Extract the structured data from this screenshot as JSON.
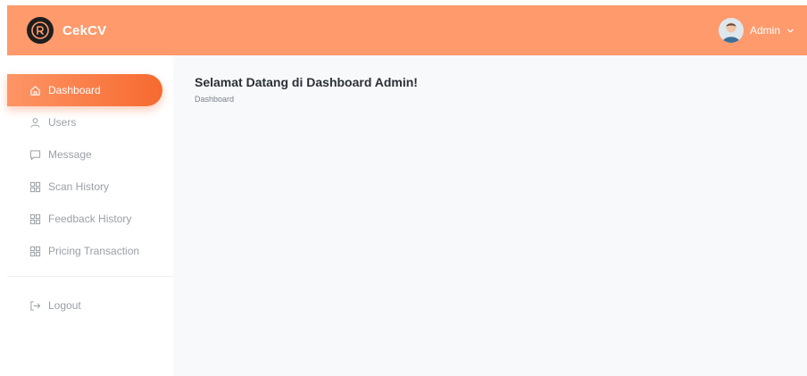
{
  "app": {
    "brand": "CekCV"
  },
  "header": {
    "user_name": "Admin"
  },
  "sidebar": {
    "items": [
      {
        "label": "Dashboard",
        "icon": "home-icon",
        "active": true
      },
      {
        "label": "Users",
        "icon": "user-icon",
        "active": false
      },
      {
        "label": "Message",
        "icon": "message-icon",
        "active": false
      },
      {
        "label": "Scan History",
        "icon": "grid-icon",
        "active": false
      },
      {
        "label": "Feedback History",
        "icon": "grid-icon",
        "active": false
      },
      {
        "label": "Pricing Transaction",
        "icon": "grid-icon",
        "active": false
      }
    ],
    "logout": {
      "label": "Logout",
      "icon": "logout-icon"
    }
  },
  "main": {
    "title": "Selamat Datang di Dashboard Admin!",
    "breadcrumb": "Dashboard"
  },
  "colors": {
    "header_bg": "#fe9a6c",
    "active_start": "#fe9566",
    "active_end": "#f66a2f",
    "muted_text": "#9aa0a8",
    "content_bg": "#f8f9fb"
  }
}
